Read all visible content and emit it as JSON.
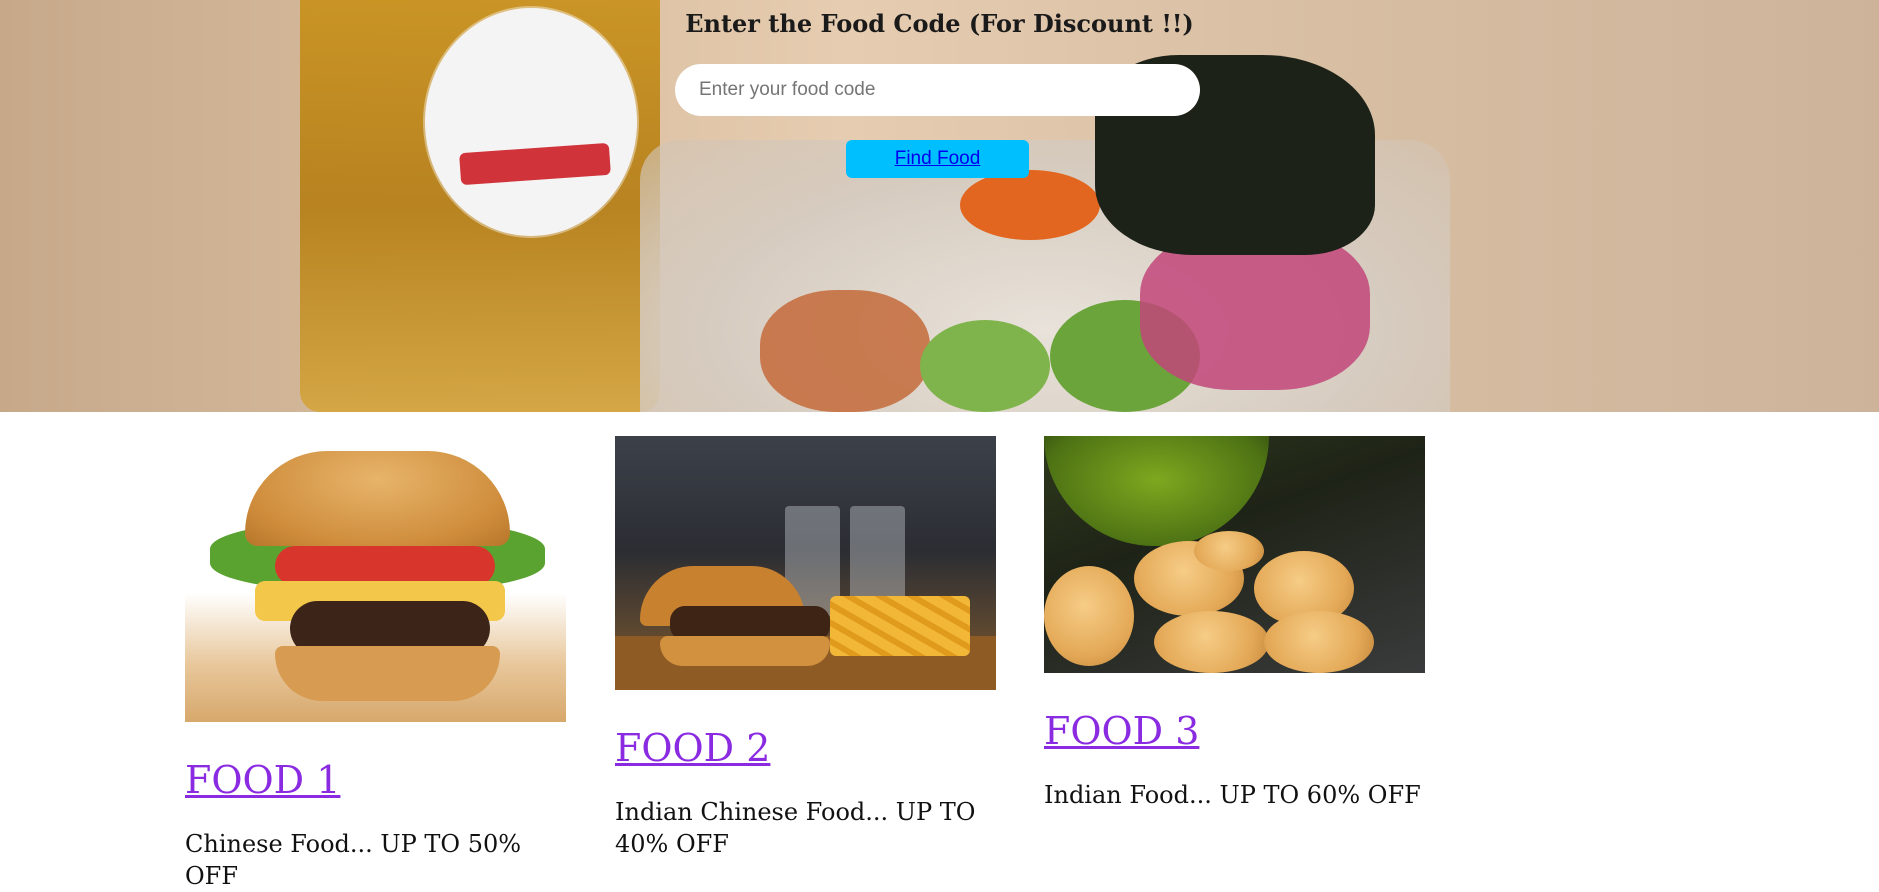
{
  "discount_section": {
    "title": "Enter the Food Code (For Discount !!)",
    "input_placeholder": "Enter your food code",
    "input_value": "",
    "button_label": "Find Food",
    "button_color": "#00bfff"
  },
  "foods": [
    {
      "title": "FOOD 1",
      "description": "Chinese Food... UP TO 50% OFF",
      "image_icon": "burger-image"
    },
    {
      "title": "FOOD 2",
      "description": "Indian Chinese Food... UP TO 40% OFF",
      "image_icon": "burger-fries-image"
    },
    {
      "title": "FOOD 3",
      "description": "Indian Food... UP TO 60% OFF",
      "image_icon": "pani-puri-image"
    }
  ],
  "colors": {
    "link_visited": "#8a2be2",
    "text": "#111111"
  }
}
